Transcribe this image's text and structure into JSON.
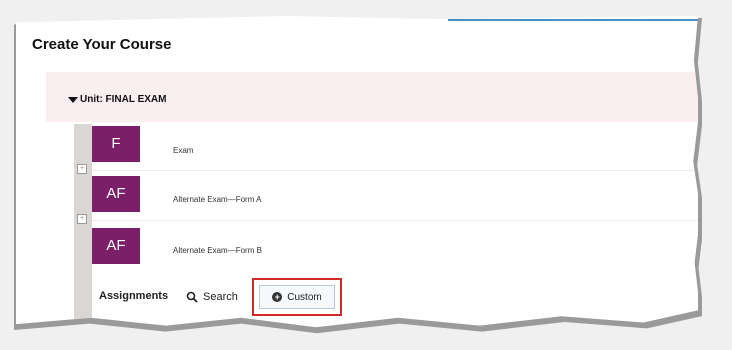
{
  "page": {
    "title": "Create Your Course"
  },
  "unit": {
    "label": "Unit: FINAL EXAM"
  },
  "items": [
    {
      "tile": "F",
      "label": "Exam"
    },
    {
      "tile": "AF",
      "label": "Alternate Exam—Form A"
    },
    {
      "tile": "AF",
      "label": "Alternate Exam—Form B"
    }
  ],
  "toolbar": {
    "assignments_label": "Assignments",
    "search_label": "Search",
    "custom_label": "Custom"
  },
  "colors": {
    "tile": "#7a1f68",
    "unit_bg": "#fbeef1",
    "highlight": "#d22a2a",
    "accent": "#4a90c8"
  },
  "icons": {
    "collapse": "triangle-down-icon",
    "search": "magnifier-icon",
    "custom": "plus-circle-icon",
    "insert": "insert-plus-icon"
  }
}
